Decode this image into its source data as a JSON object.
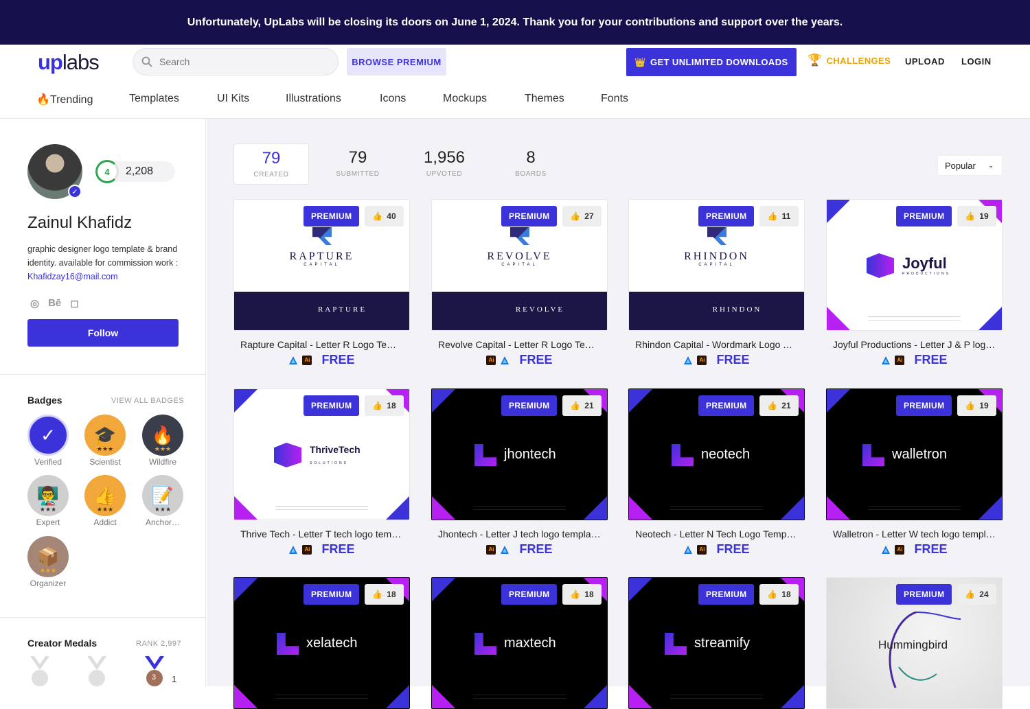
{
  "banner": {
    "text": "Unfortunately, UpLabs will be closing its doors on June 1, 2024. Thank you for your contributions and support over the years."
  },
  "header": {
    "logo_up": "up",
    "logo_labs": "labs",
    "search_placeholder": "Search",
    "browse_premium": "BROWSE PREMIUM",
    "unlimited_downloads": "GET UNLIMITED DOWNLOADS",
    "challenges": "CHALLENGES",
    "upload": "UPLOAD",
    "login": "LOGIN"
  },
  "categories": [
    "🔥Trending",
    "Templates",
    "UI Kits",
    "Illustrations",
    "Icons",
    "Mockups",
    "Themes",
    "Fonts"
  ],
  "profile": {
    "level": "4",
    "points": "2,208",
    "name": "Zainul Khafidz",
    "bio": "graphic designer logo template & brand identity. available for commission work : ",
    "email": "Khafidzay16@mail.com",
    "follow": "Follow"
  },
  "badges_section": {
    "title": "Badges",
    "view_all": "VIEW ALL BADGES",
    "items": [
      {
        "label": "Verified",
        "icon": "check-icon",
        "color": "#3b33d9",
        "stars": ""
      },
      {
        "label": "Scientist",
        "icon": "graduation-cap-icon",
        "color": "#f2a73b",
        "stars": "★★★"
      },
      {
        "label": "Wildfire",
        "icon": "fire-icon",
        "color": "#3a3e4a",
        "stars": "★★★"
      },
      {
        "label": "Expert",
        "icon": "expert-icon",
        "color": "#cfcfcf",
        "stars": "★★★"
      },
      {
        "label": "Addict",
        "icon": "thumbs-up-icon",
        "color": "#f2a73b",
        "stars": "★★★"
      },
      {
        "label": "Anchor…",
        "icon": "notepad-icon",
        "color": "#cfcfcf",
        "stars": "★★★"
      },
      {
        "label": "Organizer",
        "icon": "box-icon",
        "color": "#a48677",
        "stars": "★★★"
      }
    ]
  },
  "medals_section": {
    "title": "Creator Medals",
    "rank": "RANK 2,997",
    "bronze_count": "1",
    "bronze_number": "3"
  },
  "stats": [
    {
      "value": "79",
      "label": "CREATED"
    },
    {
      "value": "79",
      "label": "SUBMITTED"
    },
    {
      "value": "1,956",
      "label": "UPVOTED"
    },
    {
      "value": "8",
      "label": "BOARDS"
    }
  ],
  "sort": {
    "value": "Popular"
  },
  "premium_label": "PREMIUM",
  "free_label": "FREE",
  "cards": [
    {
      "title": "Rapture Capital - Letter R Logo Tem…",
      "likes": "40",
      "brand": "RAPTURE",
      "sub": "CAPITAL",
      "style": "split"
    },
    {
      "title": "Revolve Capital - Letter R Logo Tem…",
      "likes": "27",
      "brand": "REVOLVE",
      "sub": "CAPITAL",
      "style": "split"
    },
    {
      "title": "Rhindon Capital - Wordmark Logo T…",
      "likes": "11",
      "brand": "RHINDON",
      "sub": "CAPITAL",
      "style": "split"
    },
    {
      "title": "Joyful Productions - Letter J & P log…",
      "likes": "19",
      "brand": "Joyful",
      "sub": "PRODUCTIONS",
      "style": "light"
    },
    {
      "title": "Thrive Tech - Letter T tech logo tem…",
      "likes": "18",
      "brand": "ThriveTech",
      "sub": "SOLUTIONS",
      "style": "light"
    },
    {
      "title": "Jhontech - Letter J tech logo templa…",
      "likes": "21",
      "brand": "jhontech",
      "sub": "",
      "style": "dark"
    },
    {
      "title": "Neotech - Letter N Tech Logo Templ…",
      "likes": "21",
      "brand": "neotech",
      "sub": "",
      "style": "dark"
    },
    {
      "title": "Walletron - Letter W tech logo templ…",
      "likes": "19",
      "brand": "walletron",
      "sub": "",
      "style": "dark"
    },
    {
      "title": "",
      "likes": "18",
      "brand": "xelatech",
      "sub": "",
      "style": "dark"
    },
    {
      "title": "",
      "likes": "18",
      "brand": "maxtech",
      "sub": "",
      "style": "dark"
    },
    {
      "title": "",
      "likes": "18",
      "brand": "streamify",
      "sub": "",
      "style": "dark"
    },
    {
      "title": "",
      "likes": "24",
      "brand": "Hummingbird",
      "sub": "",
      "style": "grey"
    }
  ]
}
